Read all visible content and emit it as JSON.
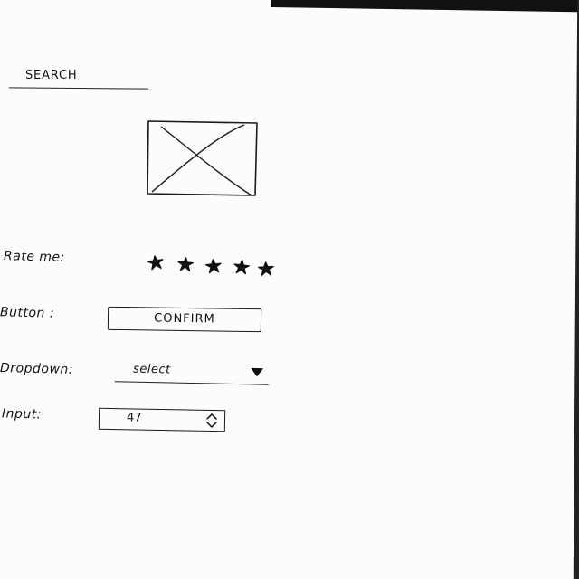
{
  "search": {
    "label": "SEARCH"
  },
  "image_placeholder": {
    "icon": "image-placeholder-icon"
  },
  "rating": {
    "label": "Rate me:",
    "stars_total": 5,
    "stars_filled": 5,
    "icon": "star-icon"
  },
  "button_row": {
    "label": "Button :",
    "button_label": "CONFIRM"
  },
  "dropdown_row": {
    "label": "Dropdown:",
    "selected": "select",
    "icon": "triangle-down-icon"
  },
  "input_row": {
    "label": "Input:",
    "value": "47",
    "icon": "stepper-icon"
  },
  "colors": {
    "ink": "#111111",
    "paper": "#fcfcfc"
  }
}
